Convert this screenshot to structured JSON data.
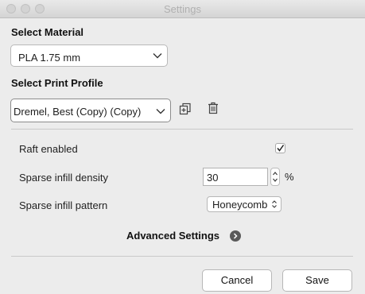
{
  "window": {
    "title": "Settings"
  },
  "material": {
    "heading": "Select Material",
    "selected": "PLA 1.75 mm"
  },
  "profile": {
    "heading": "Select Print Profile",
    "selected": "Dremel, Best (Copy) (Copy)",
    "icons": [
      "duplicate-icon",
      "trash-icon"
    ]
  },
  "settings": {
    "raft": {
      "label": "Raft enabled",
      "checked": true
    },
    "infill_density": {
      "label": "Sparse infill density",
      "value": "30",
      "unit": "%"
    },
    "infill_pattern": {
      "label": "Sparse infill pattern",
      "selected": "Honeycomb"
    }
  },
  "advanced": {
    "label": "Advanced Settings",
    "icon": "chevron-right-icon"
  },
  "buttons": {
    "cancel": "Cancel",
    "save": "Save"
  }
}
